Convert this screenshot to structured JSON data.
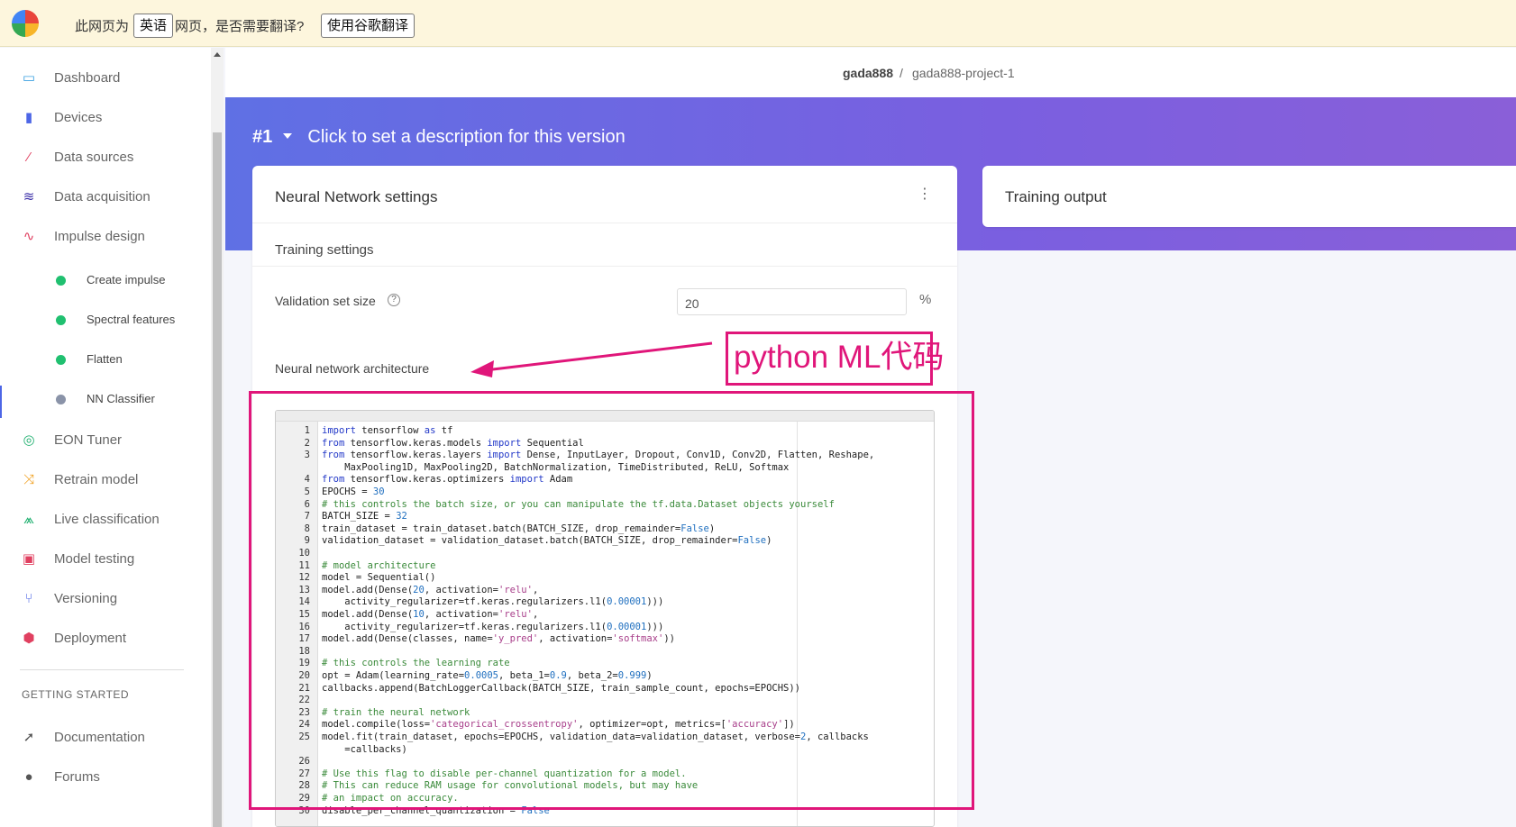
{
  "translate_bar": {
    "prefix": "此网页为",
    "language": "英语",
    "middle": "网页，是否需要翻译?",
    "button": "使用谷歌翻译"
  },
  "sidebar": {
    "items": [
      {
        "label": "Dashboard",
        "icon": "monitor-icon",
        "color": "#3aa0e0"
      },
      {
        "label": "Devices",
        "icon": "chip-icon",
        "color": "#4d66e6"
      },
      {
        "label": "Data sources",
        "icon": "wand-icon",
        "color": "#e04060"
      },
      {
        "label": "Data acquisition",
        "icon": "database-icon",
        "color": "#3b2fa8"
      },
      {
        "label": "Impulse design",
        "icon": "pulse-icon",
        "color": "#e04060"
      }
    ],
    "sub_items": [
      {
        "label": "Create impulse",
        "status_color": "#20c070"
      },
      {
        "label": "Spectral features",
        "status_color": "#20c070"
      },
      {
        "label": "Flatten",
        "status_color": "#20c070"
      },
      {
        "label": "NN Classifier",
        "status_color": "#8a93a8"
      }
    ],
    "items2": [
      {
        "label": "EON Tuner",
        "icon": "target-icon",
        "color": "#20b070"
      },
      {
        "label": "Retrain model",
        "icon": "shuffle-icon",
        "color": "#f0a020"
      },
      {
        "label": "Live classification",
        "icon": "antenna-icon",
        "color": "#20b070"
      },
      {
        "label": "Model testing",
        "icon": "clipboard-icon",
        "color": "#e04060"
      },
      {
        "label": "Versioning",
        "icon": "branch-icon",
        "color": "#4d66e6"
      },
      {
        "label": "Deployment",
        "icon": "cube-icon",
        "color": "#e04060"
      }
    ],
    "section_heading": "GETTING STARTED",
    "items3": [
      {
        "label": "Documentation",
        "icon": "rocket-icon",
        "color": "#555"
      },
      {
        "label": "Forums",
        "icon": "chat-icon",
        "color": "#555"
      }
    ]
  },
  "breadcrumb": {
    "user": "gada888",
    "sep": "/",
    "project": "gada888-project-1"
  },
  "banner": {
    "version": "#1",
    "description": "Click to set a description for this version"
  },
  "nn_card": {
    "title": "Neural Network settings",
    "training_settings": "Training settings",
    "validation_label": "Validation set size",
    "validation_value": "20",
    "validation_unit": "%",
    "architecture_label": "Neural network architecture"
  },
  "output_card": {
    "title": "Training output"
  },
  "annotation": {
    "callout": "python ML代码"
  },
  "code_lines": [
    {
      "n": "1",
      "t": "import tensorflow as tf"
    },
    {
      "n": "2",
      "t": "from tensorflow.keras.models import Sequential"
    },
    {
      "n": "3",
      "t": "from tensorflow.keras.layers import Dense, InputLayer, Dropout, Conv1D, Conv2D, Flatten, Reshape,"
    },
    {
      "n": "",
      "t": "    MaxPooling1D, MaxPooling2D, BatchNormalization, TimeDistributed, ReLU, Softmax"
    },
    {
      "n": "4",
      "t": "from tensorflow.keras.optimizers import Adam"
    },
    {
      "n": "5",
      "t": "EPOCHS = 30"
    },
    {
      "n": "6",
      "t": "# this controls the batch size, or you can manipulate the tf.data.Dataset objects yourself"
    },
    {
      "n": "7",
      "t": "BATCH_SIZE = 32"
    },
    {
      "n": "8",
      "t": "train_dataset = train_dataset.batch(BATCH_SIZE, drop_remainder=False)"
    },
    {
      "n": "9",
      "t": "validation_dataset = validation_dataset.batch(BATCH_SIZE, drop_remainder=False)"
    },
    {
      "n": "10",
      "t": ""
    },
    {
      "n": "11",
      "t": "# model architecture"
    },
    {
      "n": "12",
      "t": "model = Sequential()"
    },
    {
      "n": "13",
      "t": "model.add(Dense(20, activation='relu',"
    },
    {
      "n": "14",
      "t": "    activity_regularizer=tf.keras.regularizers.l1(0.00001)))"
    },
    {
      "n": "15",
      "t": "model.add(Dense(10, activation='relu',"
    },
    {
      "n": "16",
      "t": "    activity_regularizer=tf.keras.regularizers.l1(0.00001)))"
    },
    {
      "n": "17",
      "t": "model.add(Dense(classes, name='y_pred', activation='softmax'))"
    },
    {
      "n": "18",
      "t": ""
    },
    {
      "n": "19",
      "t": "# this controls the learning rate"
    },
    {
      "n": "20",
      "t": "opt = Adam(learning_rate=0.0005, beta_1=0.9, beta_2=0.999)"
    },
    {
      "n": "21",
      "t": "callbacks.append(BatchLoggerCallback(BATCH_SIZE, train_sample_count, epochs=EPOCHS))"
    },
    {
      "n": "22",
      "t": ""
    },
    {
      "n": "23",
      "t": "# train the neural network"
    },
    {
      "n": "24",
      "t": "model.compile(loss='categorical_crossentropy', optimizer=opt, metrics=['accuracy'])"
    },
    {
      "n": "25",
      "t": "model.fit(train_dataset, epochs=EPOCHS, validation_data=validation_dataset, verbose=2, callbacks"
    },
    {
      "n": "",
      "t": "    =callbacks)"
    },
    {
      "n": "26",
      "t": ""
    },
    {
      "n": "27",
      "t": "# Use this flag to disable per-channel quantization for a model."
    },
    {
      "n": "28",
      "t": "# This can reduce RAM usage for convolutional models, but may have"
    },
    {
      "n": "29",
      "t": "# an impact on accuracy."
    },
    {
      "n": "30",
      "t": "disable_per_channel_quantization = False"
    }
  ],
  "colors": {
    "accent": "#4d66e6",
    "highlight": "#e0167a",
    "banner_start": "#5f70e4",
    "banner_end": "#8a5fd8"
  }
}
